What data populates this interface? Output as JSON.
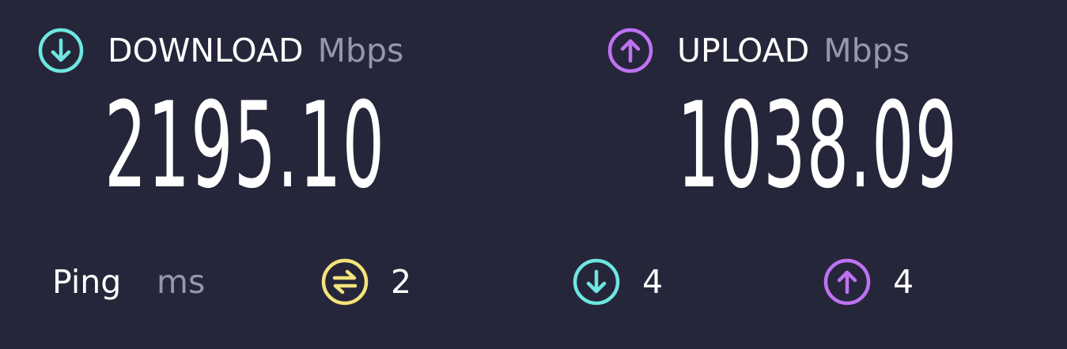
{
  "colors": {
    "background": "#26263b",
    "download_accent": "#6ee7e0",
    "upload_accent": "#bf72f2",
    "ping_accent": "#f5e37c",
    "unit_text": "#9696ad",
    "primary_text": "#ffffff"
  },
  "download": {
    "icon": "arrow-down-circle-icon",
    "label": "DOWNLOAD",
    "unit": "Mbps",
    "value": "2195.10"
  },
  "upload": {
    "icon": "arrow-up-circle-icon",
    "label": "UPLOAD",
    "unit": "Mbps",
    "value": "1038.09"
  },
  "ping": {
    "label": "Ping",
    "unit": "ms",
    "metrics": [
      {
        "icon": "jitter-exchange-icon",
        "value": "2"
      },
      {
        "icon": "arrow-down-circle-icon",
        "value": "4"
      },
      {
        "icon": "arrow-up-circle-icon",
        "value": "4"
      }
    ]
  }
}
